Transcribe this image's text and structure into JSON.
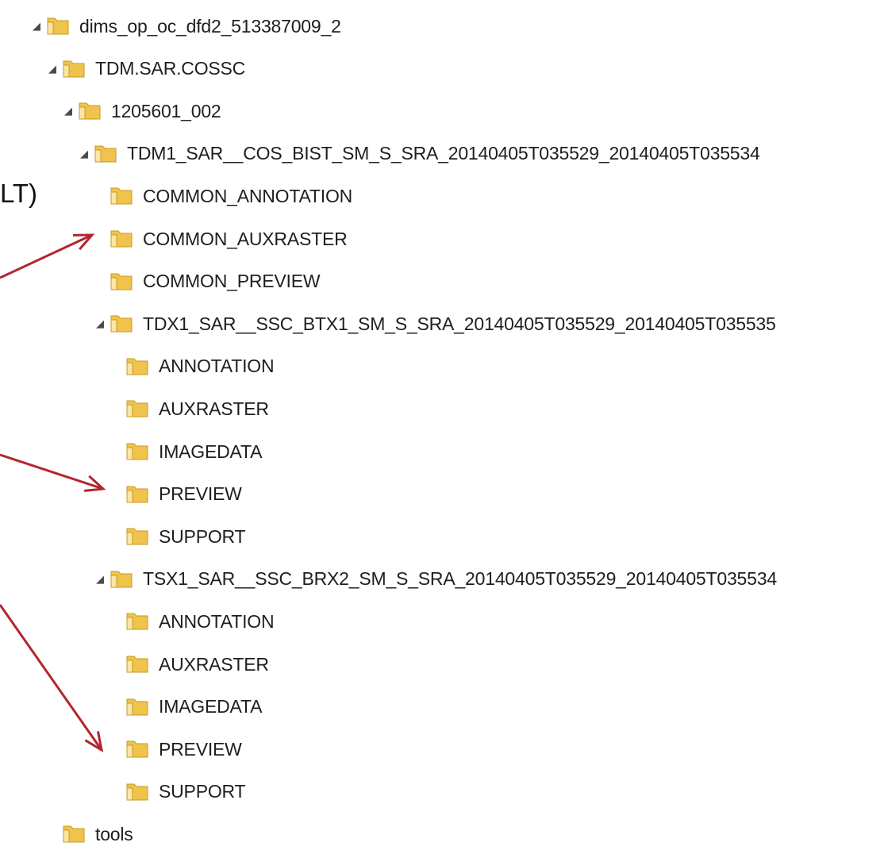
{
  "side_text": "LT)",
  "accent_arrow_color": "#b3262e",
  "folder_color": "#f0c34a",
  "tree": [
    {
      "label": "dims_op_oc_dfd2_513387009_2",
      "level": 0,
      "expanded": true
    },
    {
      "label": "TDM.SAR.COSSC",
      "level": 1,
      "expanded": true
    },
    {
      "label": "1205601_002",
      "level": 2,
      "expanded": true
    },
    {
      "label": "TDM1_SAR__COS_BIST_SM_S_SRA_20140405T035529_20140405T035534",
      "level": 3,
      "expanded": true
    },
    {
      "label": "COMMON_ANNOTATION",
      "level": 4,
      "expanded": false
    },
    {
      "label": "COMMON_AUXRASTER",
      "level": 4,
      "expanded": false
    },
    {
      "label": "COMMON_PREVIEW",
      "level": 4,
      "expanded": false
    },
    {
      "label": "TDX1_SAR__SSC_BTX1_SM_S_SRA_20140405T035529_20140405T035535",
      "level": 4,
      "expanded": true
    },
    {
      "label": "ANNOTATION",
      "level": 5,
      "expanded": false
    },
    {
      "label": "AUXRASTER",
      "level": 5,
      "expanded": false
    },
    {
      "label": "IMAGEDATA",
      "level": 5,
      "expanded": false
    },
    {
      "label": "PREVIEW",
      "level": 5,
      "expanded": false
    },
    {
      "label": "SUPPORT",
      "level": 5,
      "expanded": false
    },
    {
      "label": "TSX1_SAR__SSC_BRX2_SM_S_SRA_20140405T035529_20140405T035534",
      "level": 4,
      "expanded": true
    },
    {
      "label": "ANNOTATION",
      "level": 5,
      "expanded": false
    },
    {
      "label": "AUXRASTER",
      "level": 5,
      "expanded": false
    },
    {
      "label": "IMAGEDATA",
      "level": 5,
      "expanded": false
    },
    {
      "label": "PREVIEW",
      "level": 5,
      "expanded": false
    },
    {
      "label": "SUPPORT",
      "level": 5,
      "expanded": false
    },
    {
      "label": "tools",
      "level": 1,
      "expanded": false
    }
  ]
}
